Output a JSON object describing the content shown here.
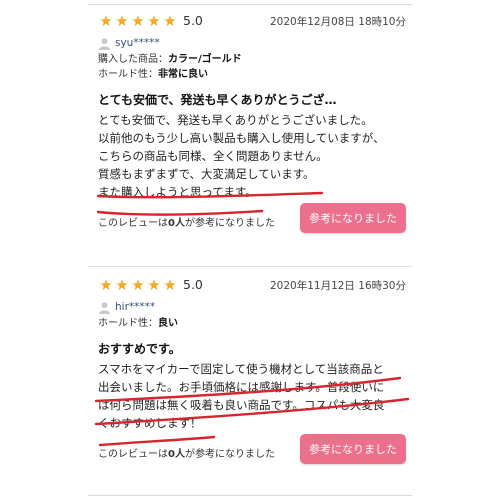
{
  "reviews": [
    {
      "rating": "5.0",
      "stars": 5,
      "date": "2020年12月08日 18時10分",
      "username": "syu*****",
      "meta1_label": "購入した商品：",
      "meta1_value": "カラー/ゴールド",
      "meta2_label": "ホールド性：",
      "meta2_value": "非常に良い",
      "title": "とても安価で、発送も早くありがとうござ…",
      "lines": [
        "とても安価で、発送も早くありがとうございました。",
        "以前他のもう少し高い製品も購入し使用していますが、",
        "こちらの商品も同様、全く問題ありません。",
        "質感もまずまずで、大変満足しています。",
        "また購入しようと思ってます。"
      ],
      "helpful_pre": "このレビューは",
      "helpful_count": "0人",
      "helpful_post": "が参考になりました",
      "button_label": "参考になりました"
    },
    {
      "rating": "5.0",
      "stars": 5,
      "date": "2020年11月12日 16時30分",
      "username": "hir*****",
      "meta1_label": "ホールド性：",
      "meta1_value": "良い",
      "title": "おすすめです。",
      "lines": [
        "スマホをマイカーで固定して使う機材として当該商品と",
        "出会いました。お手頃価格には感謝します。普段使いに",
        "は何ら問題は無く吸着も良い商品です。コスパも大変良",
        "くおすすめします！"
      ],
      "helpful_pre": "このレビューは",
      "helpful_count": "0人",
      "helpful_post": "が参考になりました",
      "button_label": "参考になりました"
    }
  ],
  "colors": {
    "star": "#f3a72a",
    "button": "#ec6f8c",
    "underline": "#d8252f",
    "username": "#3a4f7a"
  }
}
